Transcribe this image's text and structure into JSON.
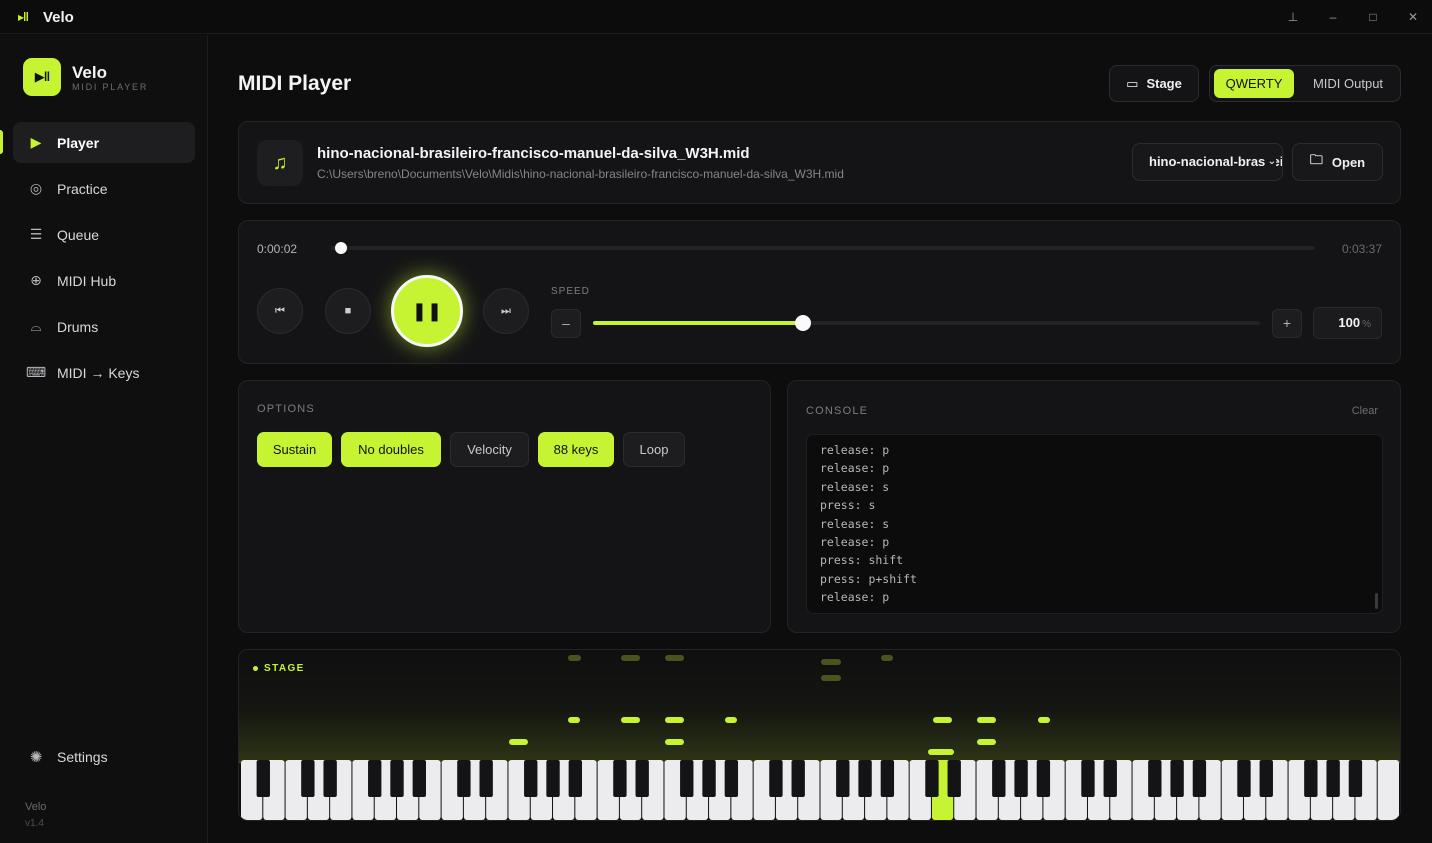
{
  "titlebar": {
    "title": "Velo",
    "logo_icon": "velo-logo-icon",
    "buttons": [
      "pin-icon",
      "minimize-icon",
      "maximize-icon",
      "close-icon"
    ]
  },
  "sidebar": {
    "brand_name": "Velo",
    "brand_sub": "MIDI PLAYER",
    "items": [
      {
        "label": "Player",
        "icon": "play-icon",
        "active": true
      },
      {
        "label": "Practice",
        "icon": "target-icon",
        "active": false
      },
      {
        "label": "Queue",
        "icon": "queue-icon",
        "active": false
      },
      {
        "label": "MIDI Hub",
        "icon": "globe-icon",
        "active": false
      },
      {
        "label": "Drums",
        "icon": "drum-icon",
        "active": false
      },
      {
        "label": "MIDI → Keys",
        "icon": "keyboard-icon",
        "active": false
      }
    ],
    "settings_label": "Settings",
    "version_name": "Velo",
    "version_num": "v1.4"
  },
  "header": {
    "title": "MIDI Player",
    "stage_button": "Stage",
    "mode_options": [
      "QWERTY",
      "MIDI Output"
    ],
    "mode_selected": "QWERTY"
  },
  "file": {
    "name": "hino-nacional-brasileiro-francisco-manuel-da-silva_W3H.mid",
    "path": "C:\\Users\\breno\\Documents\\Velo\\Midis\\hino-nacional-brasileiro-francisco-manuel-da-silva_W3H.mid",
    "selected": "hino-nacional-brasileiro",
    "open_button": "Open"
  },
  "playback": {
    "current_time": "0:00:02",
    "total_time": "0:03:37",
    "progress": 0.01,
    "speed_label": "SPEED",
    "speed_value": "100",
    "speed_unit": "%",
    "speed_fraction": 0.315
  },
  "options": {
    "label": "OPTIONS",
    "chips": [
      {
        "label": "Sustain",
        "on": true
      },
      {
        "label": "No doubles",
        "on": true
      },
      {
        "label": "Velocity",
        "on": false
      },
      {
        "label": "88 keys",
        "on": true
      },
      {
        "label": "Loop",
        "on": false
      }
    ]
  },
  "console": {
    "label": "CONSOLE",
    "clear": "Clear",
    "lines": [
      "release: p",
      "release: p",
      "release: s",
      "press: s",
      "release: s",
      "release: p",
      "press: shift",
      "press: p+shift",
      "release: p"
    ]
  },
  "stage": {
    "label": "STAGE",
    "accent": "#c6f432",
    "active_white_key": 31
  }
}
